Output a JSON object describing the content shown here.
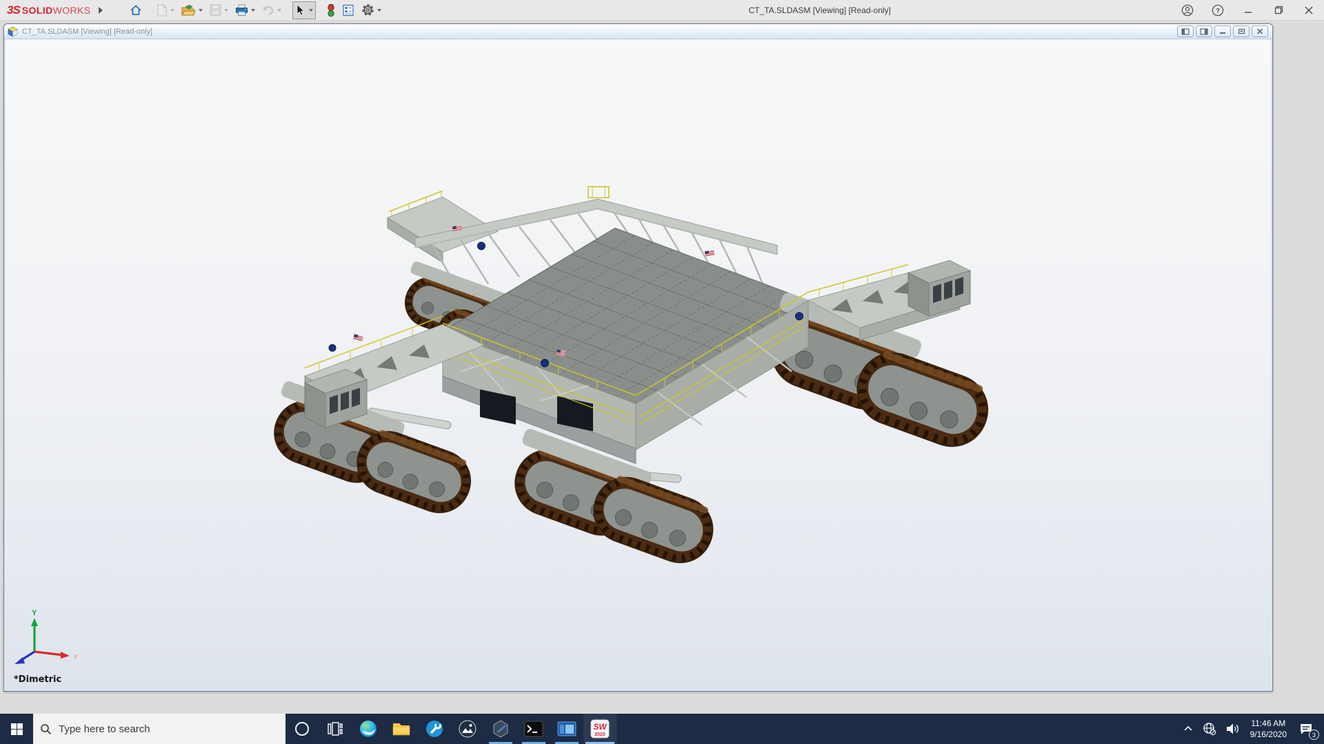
{
  "app": {
    "brand": {
      "prefix": "3S",
      "bold": "SOLID",
      "light": "WORKS"
    },
    "title": "CT_TA.SLDASM [Viewing] [Read-only]",
    "icons": {
      "help_glyph": "?"
    }
  },
  "document": {
    "title": "CT_TA.SLDASM [Viewing] [Read-only]",
    "view_label": "*Dimetric",
    "triad": {
      "x_label": "x",
      "y_label": "Y"
    }
  },
  "taskbar": {
    "search_placeholder": "Type here to search",
    "solidworks_icon": {
      "letters": "SW",
      "year": "2020"
    },
    "tray": {
      "time": "11:46 AM",
      "date": "9/16/2020",
      "notification_count": "3"
    }
  },
  "colors": {
    "brand_red": "#d6212f",
    "taskbar_bg": "#1d2b45",
    "toolbar_blue": "#2574b5",
    "track_brown": "#4a2b11",
    "steel_gray": "#c6cac4",
    "safety_yellow": "#cfc52c"
  }
}
